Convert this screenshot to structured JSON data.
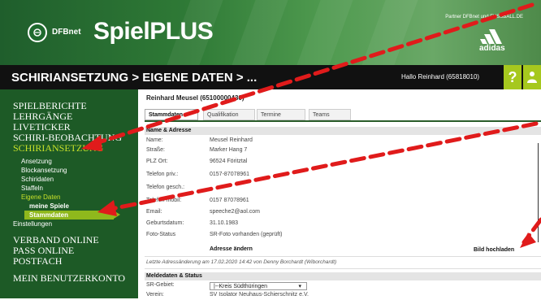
{
  "header": {
    "brand_small": "DFBnet",
    "brand": "SpielPLUS",
    "partner": "Partner DFBnet und FUSSBALL.DE",
    "sponsor": "adidas"
  },
  "titlebar": {
    "title": "SCHIRIANSETZUNG > EIGENE DATEN > ...",
    "greeting": "Hallo Reinhard (65818010)",
    "help_label": "?"
  },
  "sidebar": {
    "main1": [
      "SPIELBERICHTE",
      "LEHRGÄNGE",
      "LIVETICKER",
      "SCHIRI-BEOBACHTUNG"
    ],
    "active_main": "SCHIRIANSETZUNG",
    "sub": [
      "Ansetzung",
      "Blockansetzung",
      "Schiridaten",
      "Staffeln"
    ],
    "active_sub": "Eigene Daten",
    "subsub1": "meine Spiele",
    "subsub_selected": "Stammdaten",
    "sub_after": "Einstellungen",
    "main2": [
      "VERBAND ONLINE",
      "PASS ONLINE",
      "POSTFACH"
    ],
    "main3": "MEIN BENUTZERKONTO"
  },
  "content": {
    "person": "Reinhard Meusel (65100000430)",
    "tabs": [
      "Stammdaten",
      "Qualifikation",
      "Termine",
      "Teams"
    ],
    "section_address": "Name & Adresse",
    "rows": [
      {
        "label": "Name:",
        "value": "Meusel Reinhard"
      },
      {
        "label": "Straße:",
        "value": "Marker Hang 7"
      },
      {
        "label": "PLZ Ort:",
        "value": "96524 Föritztal"
      },
      {
        "label": "Telefon priv.:",
        "value": "0157-87078961"
      },
      {
        "label": "Telefon gesch.:",
        "value": ""
      },
      {
        "label": "Telefon mobil:",
        "value": "0157 87078961"
      },
      {
        "label": "Email:",
        "value": "speeche2@aol.com"
      },
      {
        "label": "Geburtsdatum:",
        "value": "31.10.1983"
      },
      {
        "label": "Foto-Status",
        "value": "SR-Foto vorhanden (geprüft)"
      }
    ],
    "action_address": "Adresse ändern",
    "action_photo": "Bild hochladen",
    "footnote": "Letzte Adressänderung am 17.02.2020 14:42 von Denny Borchardt (Wiborchardt)",
    "section_status": "Meldedaten & Status",
    "sr_gebiet_label": "SR-Gebiet:",
    "sr_gebiet_value": "|--Kreis Südthüringen",
    "verein_label": "Verein:",
    "verein_value": "SV Isolator Neuhaus-Schierschnitz e.V."
  },
  "colors": {
    "sidebar_bg": "#1d5a26",
    "accent_lime": "#c7e02a",
    "highlight": "#8fb81c",
    "annotation": "#e01b1b"
  }
}
